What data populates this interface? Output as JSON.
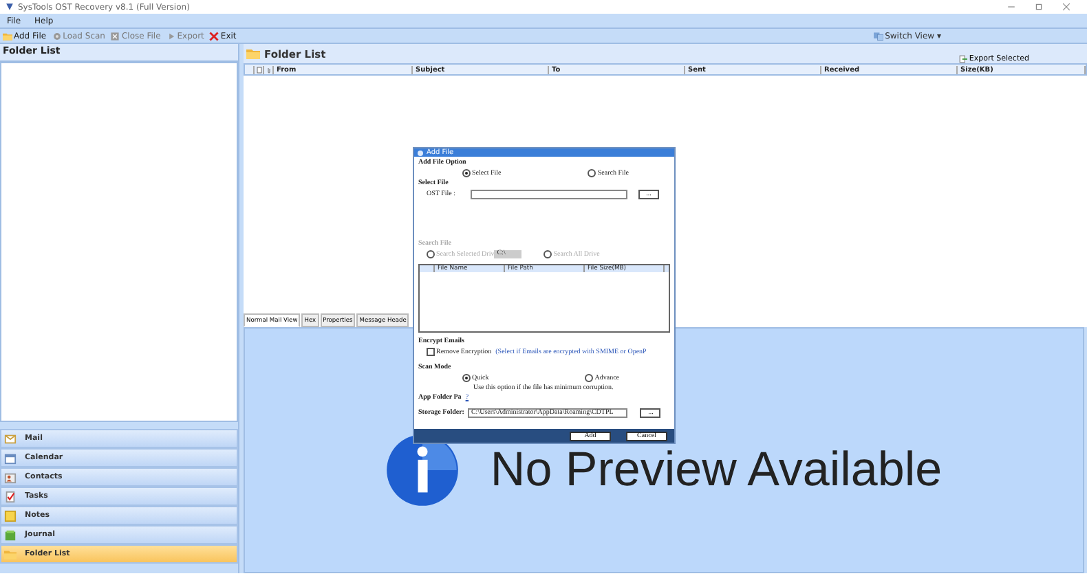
{
  "window": {
    "title": "SysTools OST Recovery v8.1 (Full Version)"
  },
  "menu": [
    "File",
    "Help"
  ],
  "toolbar": [
    {
      "label": "Add File",
      "disabled": false
    },
    {
      "label": "Load Scan",
      "disabled": true
    },
    {
      "label": "Close File",
      "disabled": true
    },
    {
      "label": "Export",
      "disabled": true
    },
    {
      "label": "Exit",
      "disabled": false
    }
  ],
  "switch_view": "Switch View ▾",
  "left_panel": {
    "title": "Folder List",
    "nav": [
      {
        "label": "Mail",
        "selected": false
      },
      {
        "label": "Calendar",
        "selected": false
      },
      {
        "label": "Contacts",
        "selected": false
      },
      {
        "label": "Tasks",
        "selected": false
      },
      {
        "label": "Notes",
        "selected": false
      },
      {
        "label": "Journal",
        "selected": false
      },
      {
        "label": "Folder List",
        "selected": true
      }
    ]
  },
  "right_panel": {
    "title": "Folder List",
    "export_button": "Export Selected",
    "columns": [
      "From",
      "Subject",
      "To",
      "Sent",
      "Received",
      "Size(KB)"
    ],
    "tabs": [
      {
        "label": "Normal Mail View",
        "selected": true
      },
      {
        "label": "Hex",
        "selected": false
      },
      {
        "label": "Properties",
        "selected": false
      },
      {
        "label": "Message Heade",
        "selected": false
      }
    ],
    "preview": "No Preview Available"
  },
  "dialog": {
    "title": "Add File",
    "add_option": {
      "legend": "Add File Option",
      "options": [
        {
          "label": "Select File",
          "selected": true
        },
        {
          "label": "Search File",
          "selected": false
        }
      ]
    },
    "select_file": {
      "legend": "Select File",
      "label": "OST File :",
      "browse": "..."
    },
    "search_file": {
      "legend": "Search File",
      "disabled": true,
      "options": [
        {
          "label": "Search Selected Driv",
          "selected": false
        },
        {
          "label": "Search All Drive",
          "selected": false
        }
      ],
      "drive": "C:\\"
    },
    "file_columns": [
      "File Name",
      "File Path",
      "File Size(MB)"
    ],
    "encrypt": {
      "legend": "Encrypt Emails",
      "label": "Remove Encryption",
      "checked": false,
      "note": "(Select if Emails are encrypted with SMIME or OpenP"
    },
    "scan_mode": {
      "legend": "Scan Mode",
      "options": [
        {
          "label": "Quick",
          "selected": true
        },
        {
          "label": "Advance",
          "selected": false
        }
      ],
      "note": "Use this option if the file has minimum corruption."
    },
    "app_folder": {
      "label": "App Folder Pa",
      "help": "?"
    },
    "storage": {
      "label": "Storage Folder:",
      "value": "C:\\Users\\Administrator\\AppData\\Roaming\\CDTPL",
      "browse": "..."
    },
    "buttons": [
      "Add",
      "Cancel"
    ]
  }
}
